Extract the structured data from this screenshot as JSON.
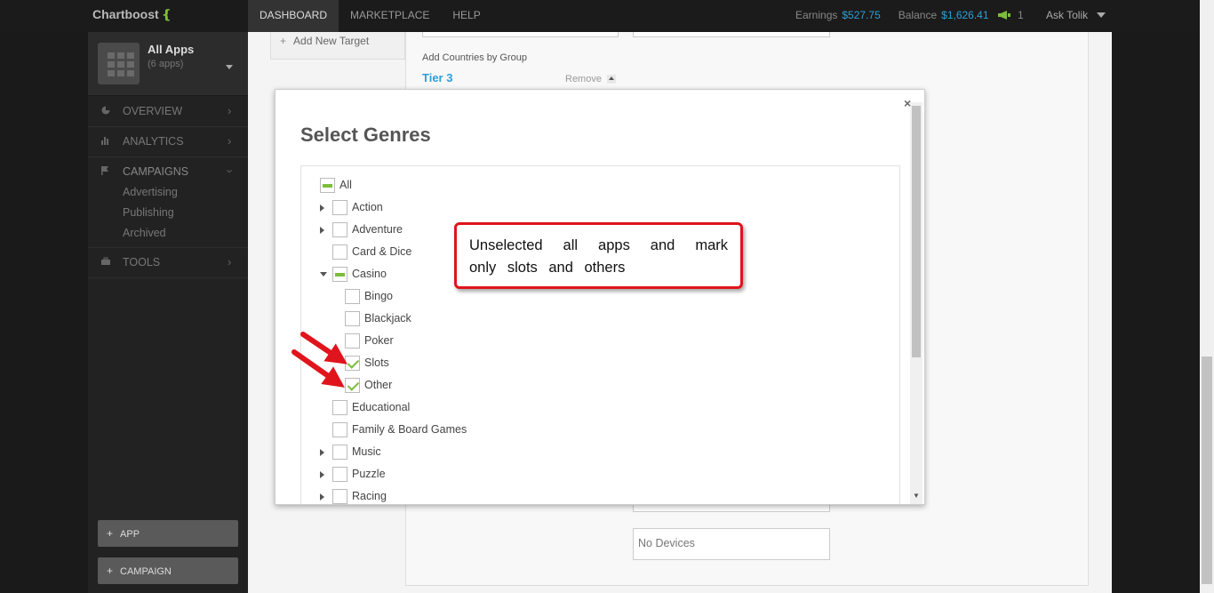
{
  "app": {
    "logo": "Chartboost"
  },
  "topnav": {
    "tabs": [
      "DASHBOARD",
      "MARKETPLACE",
      "HELP"
    ],
    "earnings_label": "Earnings",
    "earnings_value": "$527.75",
    "balance_label": "Balance",
    "balance_value": "$1,626.41",
    "notifications_count": "1",
    "user_menu": "Ask Tolik"
  },
  "sidebar": {
    "apps_title": "All Apps",
    "apps_subtitle": "(6 apps)",
    "items": [
      {
        "label": "OVERVIEW",
        "icon": "pie-chart-icon"
      },
      {
        "label": "ANALYTICS",
        "icon": "bar-chart-icon"
      },
      {
        "label": "CAMPAIGNS",
        "icon": "flag-icon"
      },
      {
        "label": "TOOLS",
        "icon": "briefcase-icon"
      }
    ],
    "campaign_subitems": [
      "Advertising",
      "Publishing",
      "Archived"
    ],
    "buttons": {
      "add_app": "APP",
      "add_campaign": "CAMPAIGN"
    }
  },
  "background": {
    "add_target": "Add New Target",
    "countries_by_group": "Add Countries by Group",
    "tier": "Tier 3",
    "remove": "Remove",
    "no_devices": "No Devices"
  },
  "modal": {
    "title": "Select Genres",
    "close": "×",
    "genres": [
      {
        "label": "All",
        "state": "partial",
        "level": 0,
        "expander": "none"
      },
      {
        "label": "Action",
        "state": "unchecked",
        "level": 1,
        "expander": "collapsed"
      },
      {
        "label": "Adventure",
        "state": "unchecked",
        "level": 1,
        "expander": "collapsed"
      },
      {
        "label": "Card & Dice",
        "state": "unchecked",
        "level": 1,
        "expander": "none"
      },
      {
        "label": "Casino",
        "state": "partial",
        "level": 1,
        "expander": "expanded"
      },
      {
        "label": "Bingo",
        "state": "unchecked",
        "level": 2,
        "expander": "none"
      },
      {
        "label": "Blackjack",
        "state": "unchecked",
        "level": 2,
        "expander": "none"
      },
      {
        "label": "Poker",
        "state": "unchecked",
        "level": 2,
        "expander": "none"
      },
      {
        "label": "Slots",
        "state": "checked",
        "level": 2,
        "expander": "none"
      },
      {
        "label": "Other",
        "state": "checked",
        "level": 2,
        "expander": "none"
      },
      {
        "label": "Educational",
        "state": "unchecked",
        "level": 1,
        "expander": "none"
      },
      {
        "label": "Family & Board Games",
        "state": "unchecked",
        "level": 1,
        "expander": "none"
      },
      {
        "label": "Music",
        "state": "unchecked",
        "level": 1,
        "expander": "collapsed"
      },
      {
        "label": "Puzzle",
        "state": "unchecked",
        "level": 1,
        "expander": "collapsed"
      },
      {
        "label": "Racing",
        "state": "unchecked",
        "level": 1,
        "expander": "collapsed"
      }
    ]
  },
  "annotation": {
    "text": "Unselected all apps and mark only slots and others",
    "border_color": "#e0141c"
  },
  "colors": {
    "accent_green": "#7cbd3b",
    "link_blue": "#2d9fd8"
  }
}
